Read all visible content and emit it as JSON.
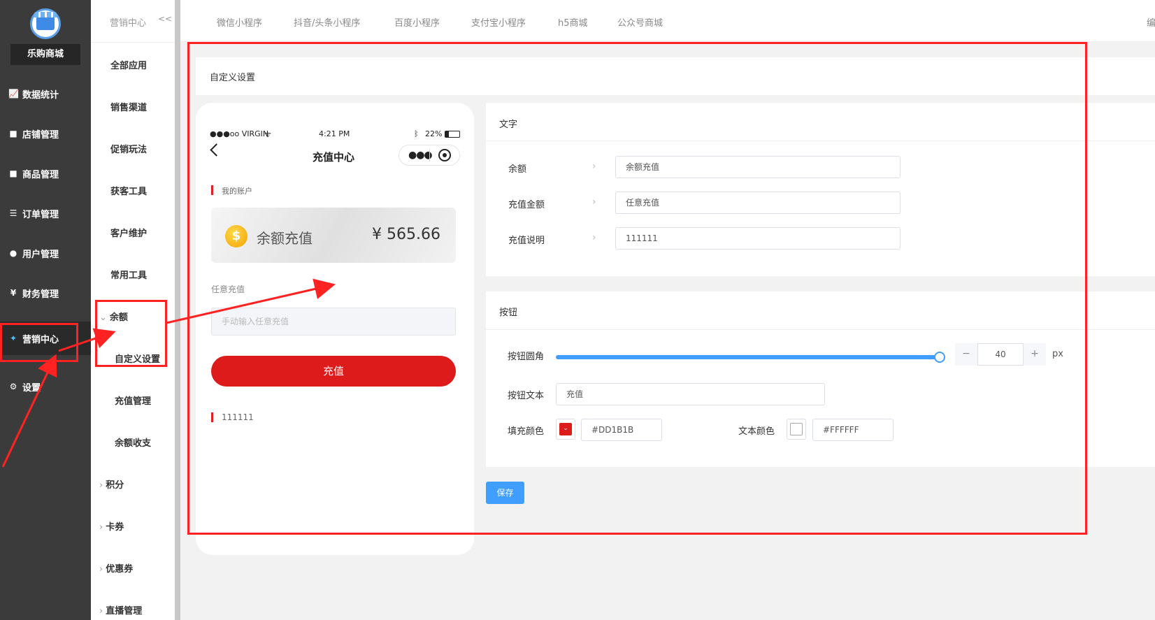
{
  "app": {
    "name": "乐购商城"
  },
  "sidebar": {
    "items": [
      {
        "label": "数据统计",
        "icon": "chart-icon"
      },
      {
        "label": "店铺管理",
        "icon": "store-icon"
      },
      {
        "label": "商品管理",
        "icon": "goods-icon"
      },
      {
        "label": "订单管理",
        "icon": "order-icon"
      },
      {
        "label": "用户管理",
        "icon": "user-icon"
      },
      {
        "label": "财务管理",
        "icon": "finance-icon"
      },
      {
        "label": "营销中心",
        "icon": "marketing-icon",
        "active": true
      },
      {
        "label": "设置",
        "icon": "gear-icon"
      }
    ]
  },
  "subnav": {
    "title": "营销中心",
    "collapse": "<<",
    "items": [
      "全部应用",
      "销售渠道",
      "促销玩法",
      "获客工具",
      "客户维护",
      "常用工具"
    ],
    "balance_group": "余额",
    "balance_children": [
      "自定义设置",
      "充值管理",
      "余额收支"
    ],
    "groups": [
      "积分",
      "卡券",
      "优惠券",
      "直播管理"
    ]
  },
  "topbar": {
    "tabs": [
      "微信小程序",
      "抖音/头条小程序",
      "百度小程序",
      "支付宝小程序",
      "h5商城",
      "公众号商城"
    ],
    "edge_text": "编"
  },
  "section": {
    "title": "自定义设置"
  },
  "phone": {
    "status_carrier": "●●●oo VIRGIN",
    "status_time": "4:21 PM",
    "status_battery": "22%",
    "page_title": "充值中心",
    "my_account": "我的账户",
    "balance_label": "余额充值",
    "balance_value": "¥ 565.66",
    "coin_symbol": "$",
    "any_amount_label": "任意充值",
    "input_placeholder": "手动输入任意充值",
    "button_text": "充值",
    "description": "111111"
  },
  "text_settings": {
    "title": "文字",
    "rows": [
      {
        "label": "余额",
        "value": "余额充值"
      },
      {
        "label": "充值金额",
        "value": "任意充值"
      },
      {
        "label": "充值说明",
        "value": "111111"
      }
    ]
  },
  "button_settings": {
    "title": "按钮",
    "radius_label": "按钮圆角",
    "radius_value": "40",
    "radius_unit": "px",
    "radius_level": 1.0,
    "stepper_minus": "−",
    "stepper_plus": "+",
    "text_label": "按钮文本",
    "text_value": "充值",
    "fill_label": "填充颜色",
    "fill_color": "#DD1B1B",
    "text_color_label": "文本颜色",
    "text_color": "#FFFFFF"
  },
  "save_label": "保存",
  "colors": {
    "accent": "#409eff",
    "brand_red": "#DD1B1B",
    "sidebar": "#3b3b3b"
  }
}
